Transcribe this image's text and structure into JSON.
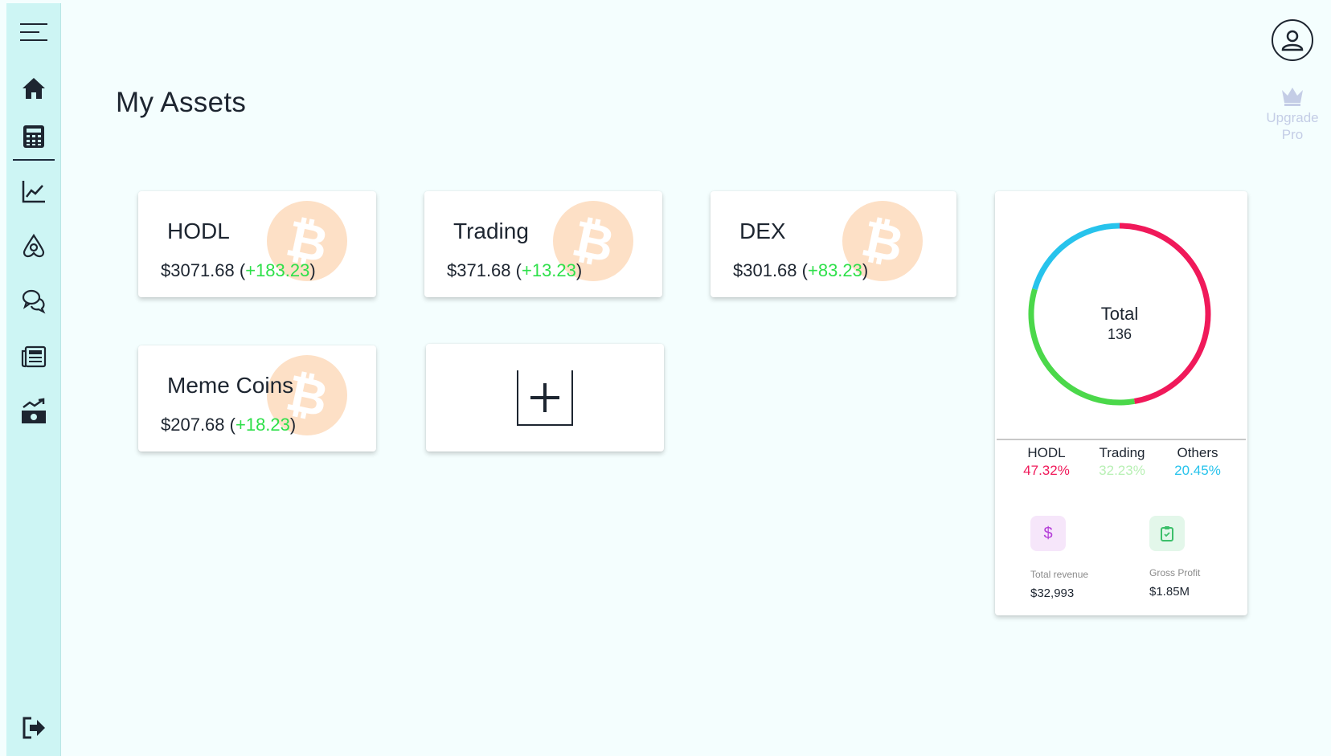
{
  "header": {
    "title": "My Assets",
    "upgrade_label_line1": "Upgrade",
    "upgrade_label_line2": "Pro"
  },
  "sidebar": {
    "items": [
      {
        "icon": "menu-icon"
      },
      {
        "icon": "home-icon"
      },
      {
        "icon": "calculator-icon"
      },
      {
        "icon": "line-chart-icon"
      },
      {
        "icon": "airbnb-icon"
      },
      {
        "icon": "chat-icon"
      },
      {
        "icon": "news-icon"
      },
      {
        "icon": "money-growth-icon"
      },
      {
        "icon": "logout-icon"
      }
    ]
  },
  "cards": [
    {
      "name": "HODL",
      "amount": "$3071.68",
      "change": "+183.23"
    },
    {
      "name": "Trading",
      "amount": "$371.68",
      "change": "+13.23"
    },
    {
      "name": "DEX",
      "amount": "$301.68",
      "change": "+83.23"
    },
    {
      "name": "Meme Coins",
      "amount": "$207.68",
      "change": "+18.23"
    }
  ],
  "summary": {
    "total_label": "Total",
    "total_value": "136",
    "legend": [
      {
        "name": "HODL",
        "percent": "47.32%",
        "color": "#f0195a"
      },
      {
        "name": "Trading",
        "percent": "32.23%",
        "color": "#66e36a"
      },
      {
        "name": "Others",
        "percent": "20.45%",
        "color": "#27c3ec"
      }
    ],
    "total_revenue_label": "Total revenue",
    "total_revenue_value": "$32,993",
    "gross_profit_label": "Gross Profit",
    "gross_profit_value": "$1.85M"
  },
  "chart_data": {
    "type": "pie",
    "categories": [
      "HODL",
      "Trading",
      "Others"
    ],
    "values": [
      47.32,
      32.23,
      20.45
    ],
    "title": "",
    "colors": [
      "#f0195a",
      "#4bd84a",
      "#27c3ec"
    ]
  }
}
